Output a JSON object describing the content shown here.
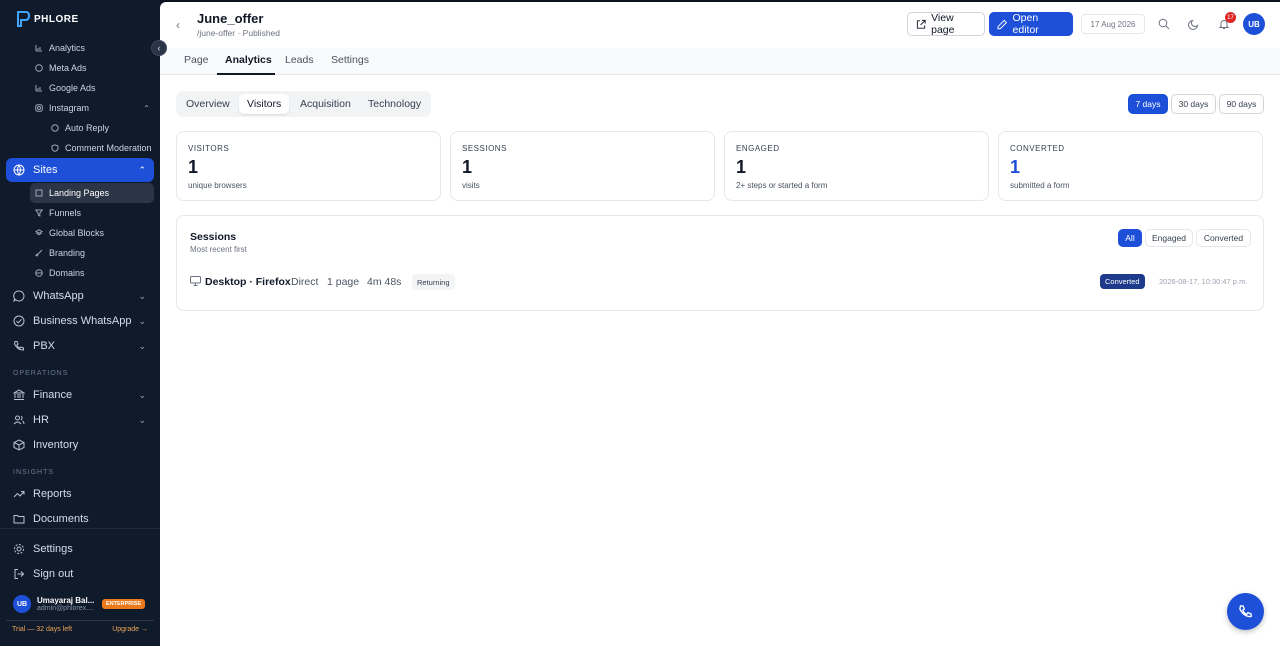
{
  "app": {
    "logo_text": "PHLORE"
  },
  "sidebar": {
    "subitems_top": [
      {
        "label": "Analytics",
        "icon": "bar-chart-icon"
      },
      {
        "label": "Meta Ads",
        "icon": "globe-icon"
      },
      {
        "label": "Google Ads",
        "icon": "bar-chart-icon"
      },
      {
        "label": "Instagram",
        "icon": "instagram-icon"
      }
    ],
    "instagram_children": [
      {
        "label": "Auto Reply",
        "icon": "chat-icon"
      },
      {
        "label": "Comment Moderation",
        "icon": "shield-icon"
      }
    ],
    "sites_label": "Sites",
    "sites_children": [
      {
        "label": "Landing Pages",
        "icon": "page-icon"
      },
      {
        "label": "Funnels",
        "icon": "funnel-icon"
      },
      {
        "label": "Global Blocks",
        "icon": "blocks-icon"
      },
      {
        "label": "Branding",
        "icon": "brush-icon"
      },
      {
        "label": "Domains",
        "icon": "globe-icon"
      }
    ],
    "groups": {
      "whatsapp": "WhatsApp",
      "business_whatsapp": "Business WhatsApp",
      "pbx": "PBX",
      "operations_header": "OPERATIONS",
      "finance": "Finance",
      "hr": "HR",
      "inventory": "Inventory",
      "insights_header": "INSIGHTS",
      "reports": "Reports",
      "documents": "Documents",
      "settings": "Settings",
      "sign_out": "Sign out"
    },
    "user": {
      "initials": "UB",
      "name": "Umayaraj Bal...",
      "email": "admin@phlorex....",
      "plan_badge": "ENTERPRISE"
    },
    "trial": {
      "text": "Trial — 32 days left",
      "upgrade": "Upgrade →"
    }
  },
  "header": {
    "title": "June_offer",
    "subtitle": "/june-offer · Published",
    "view_page": "View page",
    "open_editor": "Open editor",
    "date": "17 Aug 2026",
    "notifications_count": "17",
    "avatar_initials": "UB"
  },
  "tabs": [
    "Page",
    "Analytics",
    "Leads",
    "Settings"
  ],
  "active_tab": "Analytics",
  "subtabs": [
    "Overview",
    "Visitors",
    "Acquisition",
    "Technology"
  ],
  "active_subtab": "Visitors",
  "ranges": [
    "7 days",
    "30 days",
    "90 days"
  ],
  "active_range": "7 days",
  "stats": [
    {
      "label": "VISITORS",
      "value": "1",
      "hint": "unique browsers"
    },
    {
      "label": "SESSIONS",
      "value": "1",
      "hint": "visits"
    },
    {
      "label": "ENGAGED",
      "value": "1",
      "hint": "2+ steps or started a form"
    },
    {
      "label": "CONVERTED",
      "value": "1",
      "hint": "submitted a form"
    }
  ],
  "sessions": {
    "title": "Sessions",
    "subtitle": "Most recent first",
    "filters": [
      "All",
      "Engaged",
      "Converted"
    ],
    "active_filter": "All",
    "rows": [
      {
        "device": "Desktop · Firefox",
        "source": "Direct",
        "pages": "1 page",
        "duration": "4m 48s",
        "visitor_type": "Returning",
        "status": "Converted",
        "timestamp": "2026-08-17, 10:30:47 p.m."
      }
    ]
  },
  "colors": {
    "accent": "#1d4fd8",
    "sidebar_bg": "#0f1a2b",
    "badge_orange": "#ea7a1c",
    "notif_red": "#dc2626"
  }
}
